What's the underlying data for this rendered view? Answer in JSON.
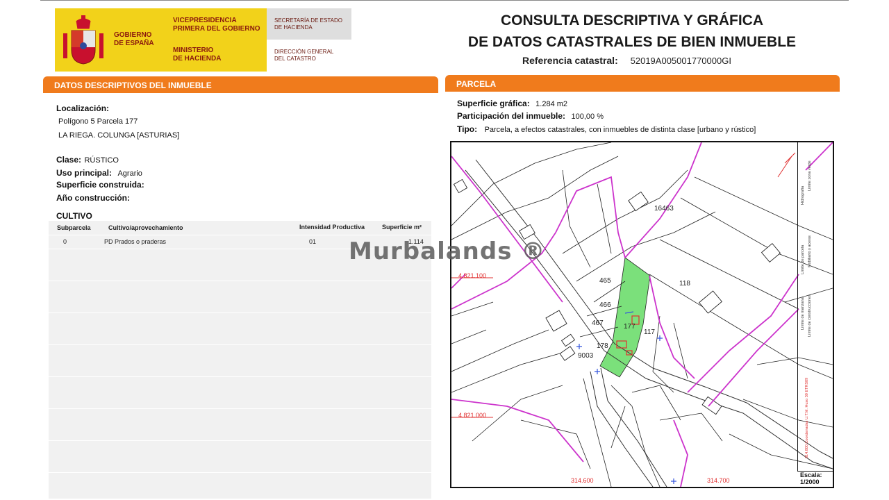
{
  "header": {
    "gobierno": [
      "GOBIERNO",
      "DE ESPAÑA"
    ],
    "vicepresidencia": [
      "VICEPRESIDENCIA",
      "PRIMERA DEL GOBIERNO"
    ],
    "ministerio": [
      "MINISTERIO",
      "DE HACIENDA"
    ],
    "secretaria": [
      "SECRETARÍA DE ESTADO",
      "DE HACIENDA"
    ],
    "direccion": [
      "DIRECCIÓN GENERAL",
      "DEL CATASTRO"
    ],
    "title_line1": "CONSULTA DESCRIPTIVA Y GRÁFICA",
    "title_line2": "DE DATOS CATASTRALES DE BIEN INMUEBLE",
    "ref_label": "Referencia catastral:",
    "ref_value": "52019A005001770000GI"
  },
  "left": {
    "section_title": "DATOS DESCRIPTIVOS DEL INMUEBLE",
    "localizacion_label": "Localización:",
    "localizacion_line1": "Polígono 5 Parcela 177",
    "localizacion_line2": "LA RIEGA. COLUNGA [ASTURIAS]",
    "clase_label": "Clase:",
    "clase_value": "RÚSTICO",
    "uso_label": "Uso principal:",
    "uso_value": "Agrario",
    "superficie_label": "Superficie construida:",
    "anio_label": "Año construcción:",
    "cultivo_title": "CULTIVO",
    "table_headers": [
      "Subparcela",
      "Cultivo/aprovechamiento",
      "Intensidad Productiva",
      "Superficie m²"
    ],
    "table_rows": [
      [
        "0",
        "PD Prados o praderas",
        "01",
        "1.114"
      ]
    ]
  },
  "right": {
    "section_title": "PARCELA",
    "sup_label": "Superficie gráfica:",
    "sup_value": "1.284 m2",
    "part_label": "Participación del inmueble:",
    "part_value": "100,00 %",
    "tipo_label": "Tipo:",
    "tipo_value": "Parcela, a efectos catastrales, con inmuebles de distinta clase [urbano y rústico]"
  },
  "map": {
    "parcel_labels": [
      "16463",
      "465",
      "466",
      "467",
      "177",
      "178",
      "117",
      "118",
      "9003"
    ],
    "coord_labels": [
      "4.821.100",
      "4.821.000",
      "314.600",
      "314.700"
    ],
    "scale_label": "Escala:",
    "scale_value": "1/2000",
    "legend_lines": [
      "Límite de manzana",
      "Límite de parcela",
      "Hidrografía",
      "Límite de construcciones",
      "Mobiliario y aceras",
      "Límite zona verde",
      "314.800 Coordenadas U.T.M. Huso 30 ETRS89"
    ],
    "colors": {
      "parcel_fill": "#7be07b",
      "boundary": "#cc33cc",
      "coords": "#e03030"
    }
  },
  "watermark": "Murbalands ®"
}
